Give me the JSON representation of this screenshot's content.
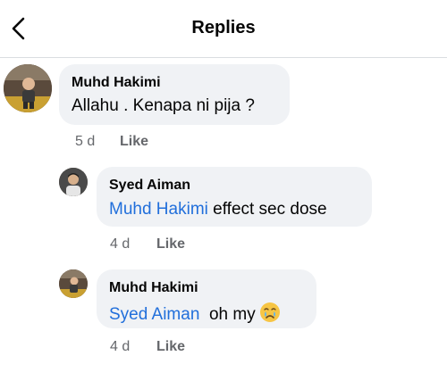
{
  "header": {
    "title": "Replies"
  },
  "comments": [
    {
      "author": "Muhd Hakimi",
      "mention": "",
      "text": "Allahu . Kenapa ni pija ?",
      "time": "5 d",
      "like": "Like"
    },
    {
      "author": "Syed Aiman",
      "mention": "Muhd Hakimi",
      "text": "effect sec dose",
      "time": "4 d",
      "like": "Like"
    },
    {
      "author": "Muhd Hakimi",
      "mention": "Syed Aiman",
      "text": "oh my",
      "time": "4 d",
      "like": "Like"
    }
  ],
  "icons": {
    "back": "chevron-left-icon",
    "emoji": "crying-face-emoji-icon"
  },
  "colors": {
    "mention": "#216fdb",
    "bubble": "#f0f2f5",
    "meta": "#65676b"
  }
}
